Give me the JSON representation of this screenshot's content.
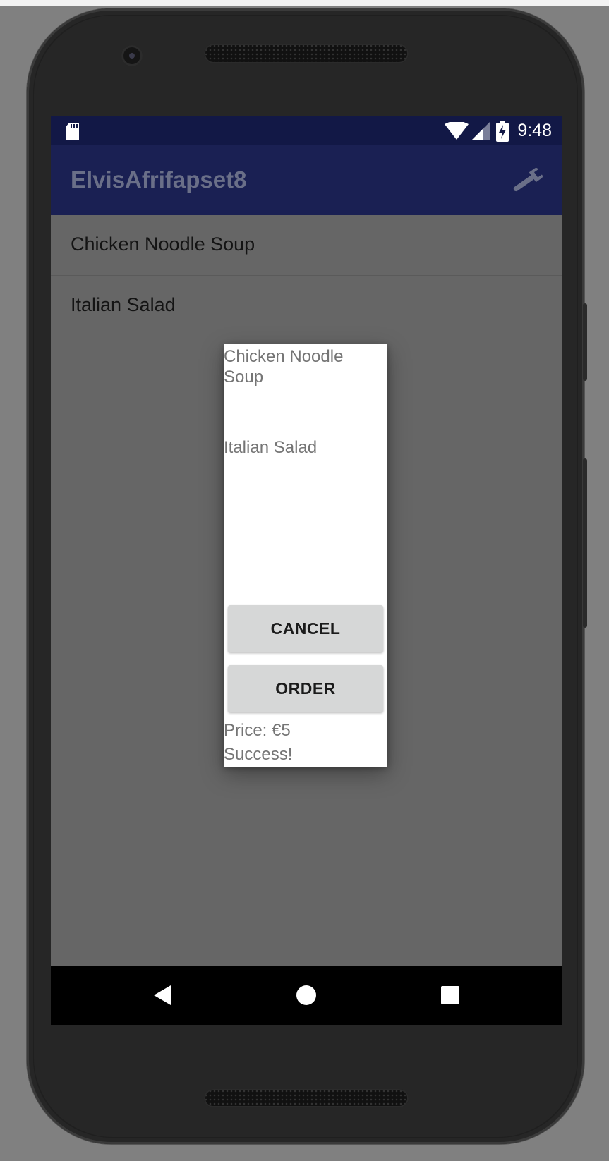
{
  "status_bar": {
    "time": "9:48"
  },
  "toolbar": {
    "title": "ElvisAfrifapset8",
    "action_icon": "wrench-icon"
  },
  "menu": {
    "items": [
      {
        "label": "Chicken Noodle Soup"
      },
      {
        "label": "Italian Salad"
      }
    ]
  },
  "dialog": {
    "item1": "Chicken Noodle Soup",
    "item2": "Italian Salad",
    "cancel_label": "CANCEL",
    "order_label": "ORDER",
    "price": "Price: €5",
    "status": "Success!"
  },
  "nav": {
    "back_icon": "back-triangle-icon",
    "home_icon": "home-circle-icon",
    "recents_icon": "recents-square-icon"
  },
  "colors": {
    "status_bar": "#121846",
    "toolbar": "#1a2053",
    "dim_overlay": "#666666"
  }
}
